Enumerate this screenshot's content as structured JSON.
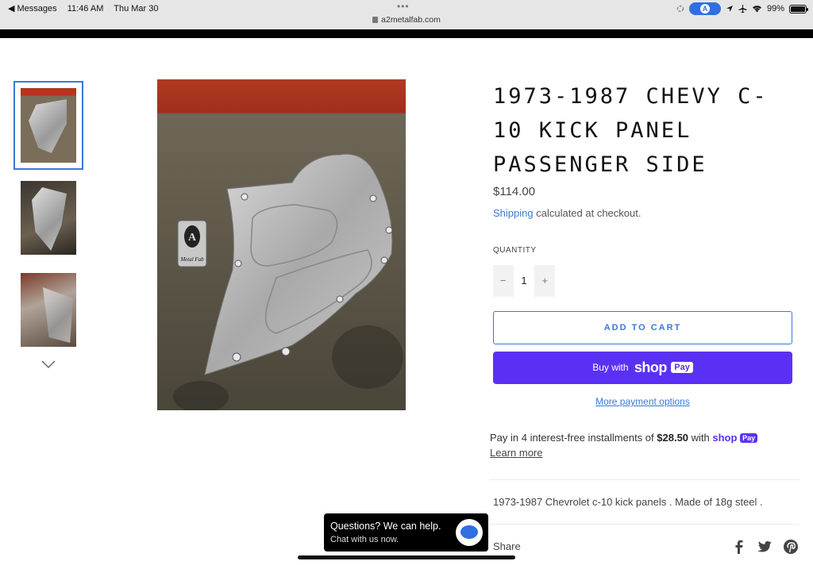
{
  "status_bar": {
    "back_app": "◀ Messages",
    "time": "11:46 AM",
    "date": "Thu Mar 30",
    "url": "a2metalfab.com",
    "battery": "99%",
    "battery_level": 0.99
  },
  "product": {
    "title": "1973-1987 CHEVY C-10 KICK PANEL PASSENGER SIDE",
    "price": "$114.00",
    "shipping_link": "Shipping",
    "shipping_text": " calculated at checkout.",
    "quantity_label": "QUANTITY",
    "quantity_value": "1",
    "add_to_cart": "ADD TO CART",
    "buy_with": "Buy with",
    "shop_word": "shop",
    "pay_word": "Pay",
    "more_payment": "More payment options",
    "install_prefix": "Pay in 4 interest-free installments of ",
    "install_amount": "$28.50",
    "install_suffix": " with ",
    "learn_more": "Learn more",
    "description": "1973-1987 Chevrolet c-10 kick panels . Made of 18g steel .",
    "share": "Share",
    "image_logo_text": "Metal Fab"
  },
  "chat": {
    "question": "Questions? We can help.",
    "subtitle": "Chat with us now."
  },
  "colors": {
    "accent_blue": "#3a78d8",
    "shop_pay_purple": "#5a31f4"
  }
}
